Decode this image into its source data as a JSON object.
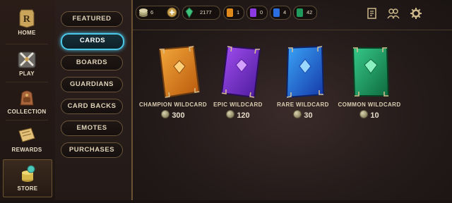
{
  "nav": {
    "items": [
      {
        "label": "HOME",
        "icon": "home-logo-icon"
      },
      {
        "label": "PLAY",
        "icon": "crossed-swords-icon"
      },
      {
        "label": "COLLECTION",
        "icon": "backpack-icon"
      },
      {
        "label": "REWARDS",
        "icon": "scroll-map-icon"
      },
      {
        "label": "STORE",
        "icon": "coin-stack-icon"
      }
    ],
    "active": "STORE"
  },
  "submenu": {
    "items": [
      "FEATURED",
      "CARDS",
      "BOARDS",
      "GUARDIANS",
      "CARD BACKS",
      "EMOTES",
      "PURCHASES"
    ],
    "active": "CARDS"
  },
  "resources": {
    "coins": "6",
    "shards": "2177",
    "champion_wildcards": "1",
    "epic_wildcards": "0",
    "rare_wildcards": "4",
    "common_wildcards": "42"
  },
  "toolbar_icons": [
    "quests-icon",
    "social-icon",
    "settings-gear-icon"
  ],
  "cards": [
    {
      "name": "CHAMPION WILDCARD",
      "price": "300",
      "color": "#e08a1c"
    },
    {
      "name": "EPIC WILDCARD",
      "price": "120",
      "color": "#7a34d4"
    },
    {
      "name": "RARE WILDCARD",
      "price": "30",
      "color": "#2a6ee0"
    },
    {
      "name": "COMMON WILDCARD",
      "price": "10",
      "color": "#1f9a5c"
    }
  ],
  "colors": {
    "accent_active": "#4bc8e8",
    "gold_border": "#6b5232"
  }
}
